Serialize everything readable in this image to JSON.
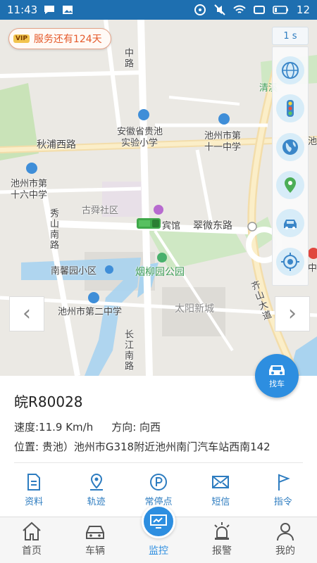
{
  "status_bar": {
    "time": "11:43",
    "battery": "12"
  },
  "map": {
    "vip_tag": "VIP",
    "service_notice": "服务还有124天",
    "refresh_interval": "1 s",
    "labels": {
      "zhong_road": "中路",
      "qingxi": "清溪",
      "park_suffix": "公园",
      "school_guichi_1": "安徽省贵池",
      "school_guichi_2": "实验小学",
      "school_11_1": "池州市第",
      "school_11_2": "十一中学",
      "qiupu_road": "秋浦西路",
      "school_16_1": "池州市第",
      "school_16_2": "十六中学",
      "gushun": "古舜社区",
      "hotel": "宾馆",
      "cuiwei_road": "翠微东路",
      "xiushan_road": "秀山南路",
      "nanxin": "南馨园小区",
      "yanliu_park": "烟柳园公园",
      "school_2": "池州市第二中学",
      "taiyang": "太阳新城",
      "qishan": "齐山大道",
      "changjiang": "长江南路",
      "chi": "池",
      "zhong": "中"
    },
    "find_car_label": "找车"
  },
  "vehicle": {
    "plate": "皖R80028",
    "speed_text": "速度:11.9 Km/h",
    "direction_text": "方向: 向西",
    "location_text": "位置: 贵池）池州市G318附近池州南门汽车站西南142"
  },
  "actions": [
    {
      "label": "资料",
      "icon": "document-icon"
    },
    {
      "label": "轨迹",
      "icon": "track-icon"
    },
    {
      "label": "常停点",
      "icon": "parking-icon"
    },
    {
      "label": "短信",
      "icon": "mail-icon"
    },
    {
      "label": "指令",
      "icon": "flag-icon"
    }
  ],
  "tabs": [
    {
      "label": "首页",
      "icon": "home-icon"
    },
    {
      "label": "车辆",
      "icon": "car-icon"
    },
    {
      "label": "监控",
      "icon": "monitor-icon",
      "active": true
    },
    {
      "label": "报警",
      "icon": "alarm-icon"
    },
    {
      "label": "我的",
      "icon": "user-icon"
    }
  ],
  "colors": {
    "status_bar": "#1e6fb0",
    "accent": "#2d8ee0",
    "action_text": "#2d7cc0",
    "vip_text": "#e55a2b"
  }
}
